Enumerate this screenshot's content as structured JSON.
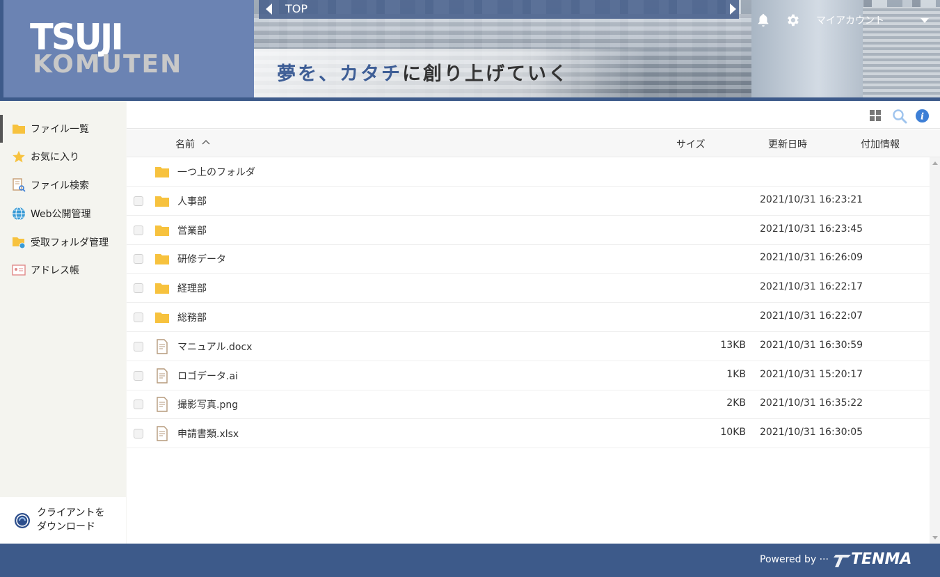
{
  "brand": {
    "logo_line1": "TSUJI",
    "logo_line2": "KOMUTEN",
    "tagline_part1": "夢を、",
    "tagline_part2": "カタチ",
    "tagline_part3": "に創り上げていく"
  },
  "header": {
    "top_label": "TOP",
    "account_label": "マイアカウント"
  },
  "sidebar": {
    "items": [
      {
        "label": "ファイル一覧",
        "icon": "folder-icon",
        "active": true
      },
      {
        "label": "お気に入り",
        "icon": "star-icon"
      },
      {
        "label": "ファイル検索",
        "icon": "file-search-icon"
      },
      {
        "label": "Web公開管理",
        "icon": "globe-icon"
      },
      {
        "label": "受取フォルダ管理",
        "icon": "folder-globe-icon"
      },
      {
        "label": "アドレス帳",
        "icon": "address-card-icon"
      }
    ],
    "client_download": "クライアントを\nダウンロード"
  },
  "table": {
    "columns": {
      "name": "名前",
      "size": "サイズ",
      "modified": "更新日時",
      "extra": "付加情報"
    },
    "rows": [
      {
        "type": "parent",
        "name": "一つ上のフォルダ",
        "size": "",
        "date": ""
      },
      {
        "type": "folder",
        "name": "人事部",
        "size": "",
        "date": "2021/10/31 16:23:21"
      },
      {
        "type": "folder",
        "name": "営業部",
        "size": "",
        "date": "2021/10/31 16:23:45"
      },
      {
        "type": "folder",
        "name": "研修データ",
        "size": "",
        "date": "2021/10/31 16:26:09"
      },
      {
        "type": "folder",
        "name": "経理部",
        "size": "",
        "date": "2021/10/31 16:22:17"
      },
      {
        "type": "folder",
        "name": "総務部",
        "size": "",
        "date": "2021/10/31 16:22:07"
      },
      {
        "type": "file",
        "name": "マニュアル.docx",
        "size": "13KB",
        "date": "2021/10/31 16:30:59"
      },
      {
        "type": "file",
        "name": "ロゴデータ.ai",
        "size": "1KB",
        "date": "2021/10/31 15:20:17"
      },
      {
        "type": "file",
        "name": "撮影写真.png",
        "size": "2KB",
        "date": "2021/10/31 16:35:22"
      },
      {
        "type": "file",
        "name": "申請書類.xlsx",
        "size": "10KB",
        "date": "2021/10/31 16:30:05"
      }
    ]
  },
  "footer": {
    "powered_by": "Powered by ···",
    "vendor": "TENMA"
  },
  "colors": {
    "header_bg": "#3d5a8a",
    "folder": "#f7c23e",
    "accent_blue": "#3e5e96",
    "info": "#3d7fd6"
  }
}
